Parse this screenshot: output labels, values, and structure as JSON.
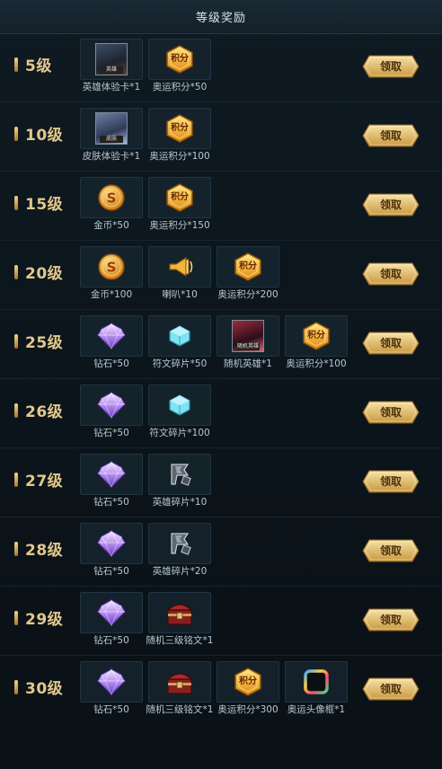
{
  "header": {
    "title": "等级奖励"
  },
  "claim_label": "领取",
  "rows": [
    {
      "level": "5级",
      "rewards": [
        {
          "icon": "hero-trial-card-icon",
          "caption": "英雄",
          "label": "英雄体验卡*1"
        },
        {
          "icon": "olympic-points-icon",
          "caption": "积分",
          "label": "奥运积分*50"
        }
      ]
    },
    {
      "level": "10级",
      "rewards": [
        {
          "icon": "skin-trial-card-icon",
          "caption": "皮肤",
          "label": "皮肤体验卡*1"
        },
        {
          "icon": "olympic-points-icon",
          "caption": "积分",
          "label": "奥运积分*100"
        }
      ]
    },
    {
      "level": "15级",
      "rewards": [
        {
          "icon": "gold-coin-icon",
          "label": "金币*50"
        },
        {
          "icon": "olympic-points-icon",
          "caption": "积分",
          "label": "奥运积分*150"
        }
      ]
    },
    {
      "level": "20级",
      "rewards": [
        {
          "icon": "gold-coin-icon",
          "label": "金币*100"
        },
        {
          "icon": "horn-icon",
          "label": "喇叭*10"
        },
        {
          "icon": "olympic-points-icon",
          "caption": "积分",
          "label": "奥运积分*200"
        }
      ]
    },
    {
      "level": "25级",
      "rewards": [
        {
          "icon": "diamond-icon",
          "label": "钻石*50"
        },
        {
          "icon": "rune-fragment-icon",
          "label": "符文碎片*50"
        },
        {
          "icon": "random-hero-icon",
          "caption": "随机英雄",
          "label": "随机英雄*1"
        },
        {
          "icon": "olympic-points-icon",
          "caption": "积分",
          "label": "奥运积分*100"
        }
      ]
    },
    {
      "level": "26级",
      "rewards": [
        {
          "icon": "diamond-icon",
          "label": "钻石*50"
        },
        {
          "icon": "rune-fragment-icon",
          "label": "符文碎片*100"
        }
      ]
    },
    {
      "level": "27级",
      "rewards": [
        {
          "icon": "diamond-icon",
          "label": "钻石*50"
        },
        {
          "icon": "hero-fragment-icon",
          "label": "英雄碎片*10"
        }
      ]
    },
    {
      "level": "28级",
      "rewards": [
        {
          "icon": "diamond-icon",
          "label": "钻石*50"
        },
        {
          "icon": "hero-fragment-icon",
          "label": "英雄碎片*20"
        }
      ]
    },
    {
      "level": "29级",
      "rewards": [
        {
          "icon": "diamond-icon",
          "label": "钻石*50"
        },
        {
          "icon": "inscription-chest-icon",
          "label": "随机三级铭文*1"
        }
      ]
    },
    {
      "level": "30级",
      "rewards": [
        {
          "icon": "diamond-icon",
          "label": "钻石*50"
        },
        {
          "icon": "inscription-chest-icon",
          "label": "随机三级铭文*1"
        },
        {
          "icon": "olympic-points-icon",
          "caption": "积分",
          "label": "奥运积分*300"
        },
        {
          "icon": "avatar-frame-icon",
          "label": "奥运头像框*1"
        }
      ]
    }
  ]
}
